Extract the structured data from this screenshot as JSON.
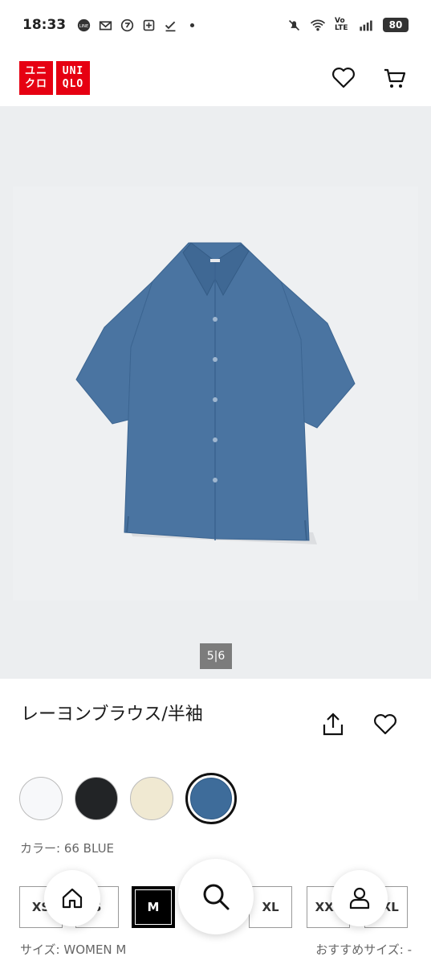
{
  "status_bar": {
    "time": "18:33",
    "left_icons": [
      "line-icon",
      "mail-icon",
      "app-icon",
      "notification-icon",
      "check-icon",
      "dot-icon"
    ],
    "right_icons": [
      "mute-icon",
      "wifi-icon",
      "volte-icon",
      "signal-icon"
    ],
    "volte": "Vo LTE",
    "battery": "80"
  },
  "header": {
    "logo_left": [
      "ユニ",
      "クロ"
    ],
    "logo_right": [
      "UNI",
      "QLO"
    ],
    "icons": [
      "heart-icon",
      "cart-icon"
    ]
  },
  "hero": {
    "pager": "5|6",
    "shirt_color": "#4a74a1"
  },
  "product": {
    "title": "レーヨンブラウス/半袖",
    "color_label": "カラー: 66 BLUE",
    "size_label": "サイズ: WOMEN M",
    "recommended_size": "おすすめサイズ: -"
  },
  "swatches": [
    {
      "name": "white",
      "color": "#f7f8fa",
      "selected": false
    },
    {
      "name": "black",
      "color": "#222426",
      "selected": false
    },
    {
      "name": "cream",
      "color": "#f0e9d2",
      "selected": false
    },
    {
      "name": "blue",
      "color": "#3e6c9a",
      "selected": true
    }
  ],
  "sizes": {
    "xs": "XS",
    "s": "S",
    "m": "M",
    "xl": "XL",
    "xxl": "XXL",
    "3xl": "3XL"
  },
  "nav": {
    "icons": [
      "home-icon",
      "search-icon",
      "account-icon"
    ]
  }
}
